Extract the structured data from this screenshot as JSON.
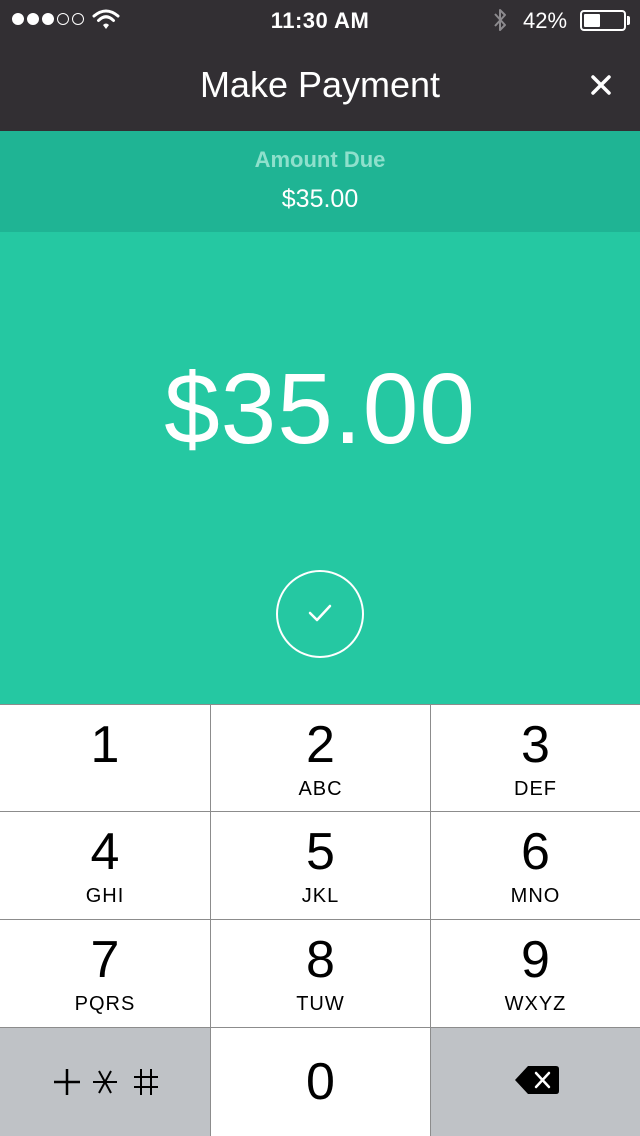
{
  "status_bar": {
    "time": "11:30 AM",
    "battery_percent": "42%",
    "battery_level": 0.42,
    "signal_bars_filled": 3,
    "signal_bars_total": 5
  },
  "nav": {
    "title": "Make Payment",
    "close_icon": "close-icon"
  },
  "amount_due": {
    "label": "Amount Due",
    "value": "$35.00"
  },
  "entry": {
    "amount": "$35.00",
    "confirm_icon": "check-circle-icon"
  },
  "keypad": {
    "keys": [
      {
        "digit": "1",
        "letters": ""
      },
      {
        "digit": "2",
        "letters": "ABC"
      },
      {
        "digit": "3",
        "letters": "DEF"
      },
      {
        "digit": "4",
        "letters": "GHI"
      },
      {
        "digit": "5",
        "letters": "JKL"
      },
      {
        "digit": "6",
        "letters": "MNO"
      },
      {
        "digit": "7",
        "letters": "PQRS"
      },
      {
        "digit": "8",
        "letters": "TUW"
      },
      {
        "digit": "9",
        "letters": "WXYZ"
      }
    ],
    "zero": "0",
    "symbols_icon": "plus-star-hash-icon",
    "delete_icon": "backspace-icon"
  },
  "colors": {
    "nav_bg": "#322f33",
    "due_bg": "#1fb494",
    "main_bg": "#25c8a2",
    "key_gray": "#bfc2c6"
  }
}
